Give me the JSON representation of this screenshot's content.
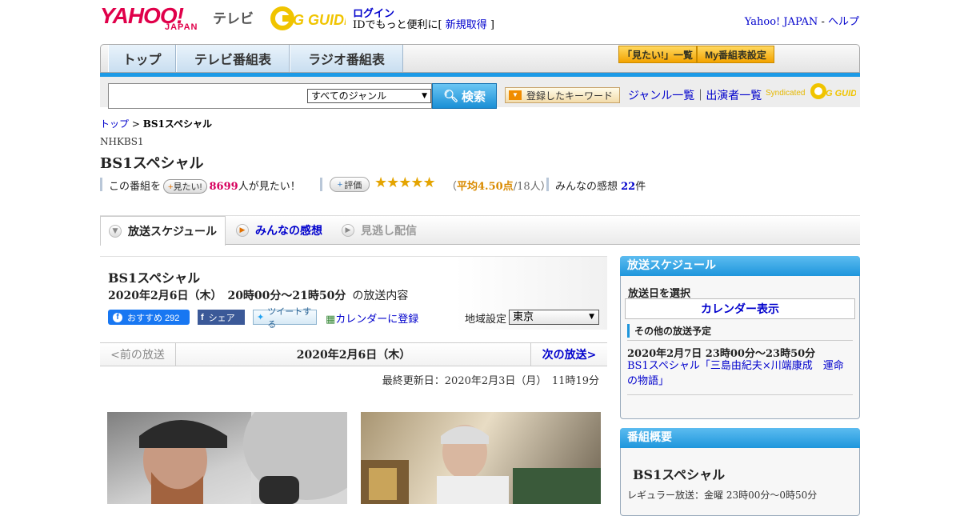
{
  "header": {
    "logo_text": "YAHOO!",
    "logo_sub": "JAPAN",
    "tv_label": "テレビ",
    "gguide_logo": "G GUIDE",
    "login": "ログイン",
    "id_prefix": "IDでもっと便利に[ ",
    "register": "新規取得",
    "id_suffix": " ]",
    "yahoo_japan": "Yahoo! JAPAN",
    "dash": " - ",
    "help": "ヘルプ"
  },
  "nav": {
    "tabs": [
      "トップ",
      "テレビ番組表",
      "ラジオ番組表"
    ],
    "mitai_list": "「見たい!」一覧",
    "my_schedule": "My番組表設定"
  },
  "search": {
    "genre_select": "すべてのジャンル",
    "button": "検索",
    "keyword_button": "登録したキーワード",
    "genre_list": "ジャンル一覧",
    "pipe": "｜",
    "performer_list": "出演者一覧",
    "syndicated": "Syndicated",
    "gguide_small": "G GUIDE"
  },
  "breadcrumb": {
    "home": "トップ",
    "separator": " > ",
    "current": "BS1スペシャル"
  },
  "program": {
    "channel": "NHKBS1",
    "title": "BS1スペシャル",
    "watch_prefix": "この番組を",
    "mitai_btn": "見たい!",
    "watch_count": "8699",
    "watch_suffix": "人が見たい！",
    "rate_btn": "評価",
    "stars": "★★★★★",
    "avg_open": "（",
    "avg_label": "平均4.50点",
    "avg_count": "/18人）",
    "impressions_label": "みんなの感想 ",
    "impressions_count": "22",
    "impressions_unit": "件",
    "rating": 4.5
  },
  "tabs": {
    "schedule": "放送スケジュール",
    "impressions": "みんなの感想",
    "missed": "見逃し配信"
  },
  "detail": {
    "title": "BS1スペシャル",
    "datetime": "2020年2月6日（木）　20時00分～21時50分",
    "content_suffix": "の放送内容",
    "fb_like": "おすすめ 292",
    "fb_share": "シェア",
    "tweet": "ツイートする",
    "calendar": "カレンダーに登録",
    "region_label": "地域設定",
    "region_value": "東京",
    "prev": "<前の放送",
    "current_date": "2020年2月6日（木）",
    "next": "次の放送>",
    "updated": "最終更新日：2020年2月3日（月）　11時19分"
  },
  "sidebar": {
    "schedule_head": "放送スケジュール",
    "select_date": "放送日を選択",
    "calendar_btn": "カレンダー表示",
    "other_head": "その他の放送予定",
    "other_date": "2020年2月7日  23時00分～23時50分",
    "other_link": "BS1スペシャル「三島由紀夫×川端康成　運命の物語」",
    "overview_head": "番組概要",
    "overview_title": "BS1スペシャル",
    "regular": "レギュラー放送：金曜 23時00分～0時50分"
  },
  "colors": {
    "accent_blue": "#1c9ae6",
    "brand_red": "#e0004a",
    "highlight_pink": "#d6005d",
    "star_gold": "#e4a400"
  },
  "icons": [
    "search-icon",
    "dropdown-arrow-icon",
    "keyword-icon",
    "plus-icon",
    "play-icon",
    "calendar-icon",
    "facebook-icon",
    "twitter-icon"
  ]
}
